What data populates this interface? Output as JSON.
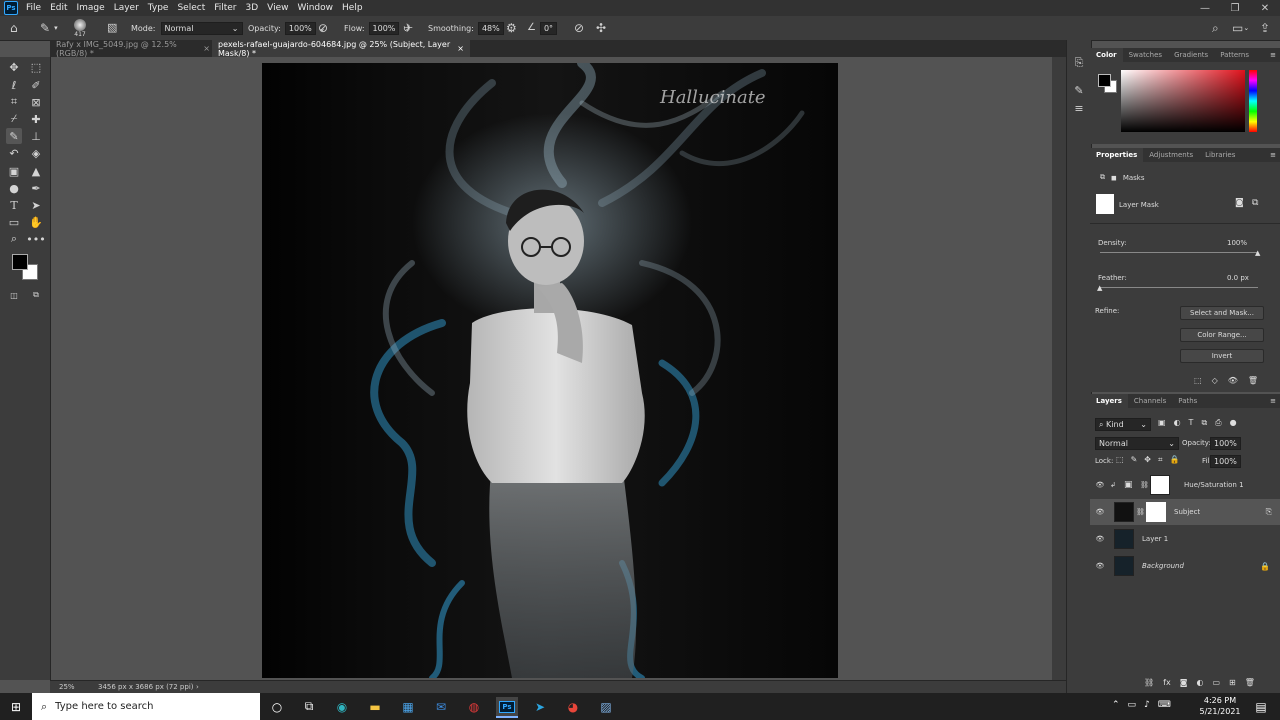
{
  "menu": {
    "logo": "Ps",
    "items": [
      "File",
      "Edit",
      "Image",
      "Layer",
      "Type",
      "Select",
      "Filter",
      "3D",
      "View",
      "Window",
      "Help"
    ]
  },
  "options_bar": {
    "brush_size": "417",
    "mode_label": "Mode:",
    "mode_value": "Normal",
    "opacity_label": "Opacity:",
    "opacity_value": "100%",
    "flow_label": "Flow:",
    "flow_value": "100%",
    "smoothing_label": "Smoothing:",
    "smoothing_value": "48%",
    "angle_value": "0°"
  },
  "tabs": [
    {
      "label": "Rafy x IMG_5049.jpg @ 12.5% (RGB/8) *",
      "active": false
    },
    {
      "label": "pexels-rafael-guajardo-604684.jpg @ 25% (Subject, Layer Mask/8) *",
      "active": true
    }
  ],
  "canvas": {
    "watermark": "Hallucinate"
  },
  "status_bar": {
    "zoom": "25%",
    "doc_size": "3456 px x 3686 px (72 ppi)"
  },
  "color_panel": {
    "tabs": [
      "Color",
      "Swatches",
      "Gradients",
      "Patterns"
    ],
    "active_tab": "Color"
  },
  "properties_panel": {
    "tabs": [
      "Properties",
      "Adjustments",
      "Libraries"
    ],
    "active_tab": "Properties",
    "section": "Masks",
    "mask_label": "Layer Mask",
    "density_label": "Density:",
    "density_value": "100%",
    "density_fraction": 1.0,
    "feather_label": "Feather:",
    "feather_value": "0.0 px",
    "feather_fraction": 0.0,
    "refine_label": "Refine:",
    "select_mask_button": "Select and Mask...",
    "color_range_button": "Color Range...",
    "invert_button": "Invert"
  },
  "layers_panel": {
    "tabs": [
      "Layers",
      "Channels",
      "Paths"
    ],
    "active_tab": "Layers",
    "filter_kind": "Kind",
    "blend_mode": "Normal",
    "opacity_label": "Opacity:",
    "opacity_value": "100%",
    "lock_label": "Lock:",
    "fill_label": "Fill:",
    "fill_value": "100%",
    "layers": [
      {
        "name": "Hue/Saturation 1",
        "selected": false,
        "italic": false
      },
      {
        "name": "Subject",
        "selected": true,
        "italic": false
      },
      {
        "name": "Layer 1",
        "selected": false,
        "italic": false
      },
      {
        "name": "Background",
        "selected": false,
        "italic": true
      }
    ]
  },
  "taskbar": {
    "search_placeholder": "Type here to search",
    "time": "4:26 PM",
    "date": "5/21/2021"
  },
  "colors": {
    "accent": "#31a8ff",
    "panel": "#3c3c3c",
    "canvas_bg": "#535353"
  }
}
